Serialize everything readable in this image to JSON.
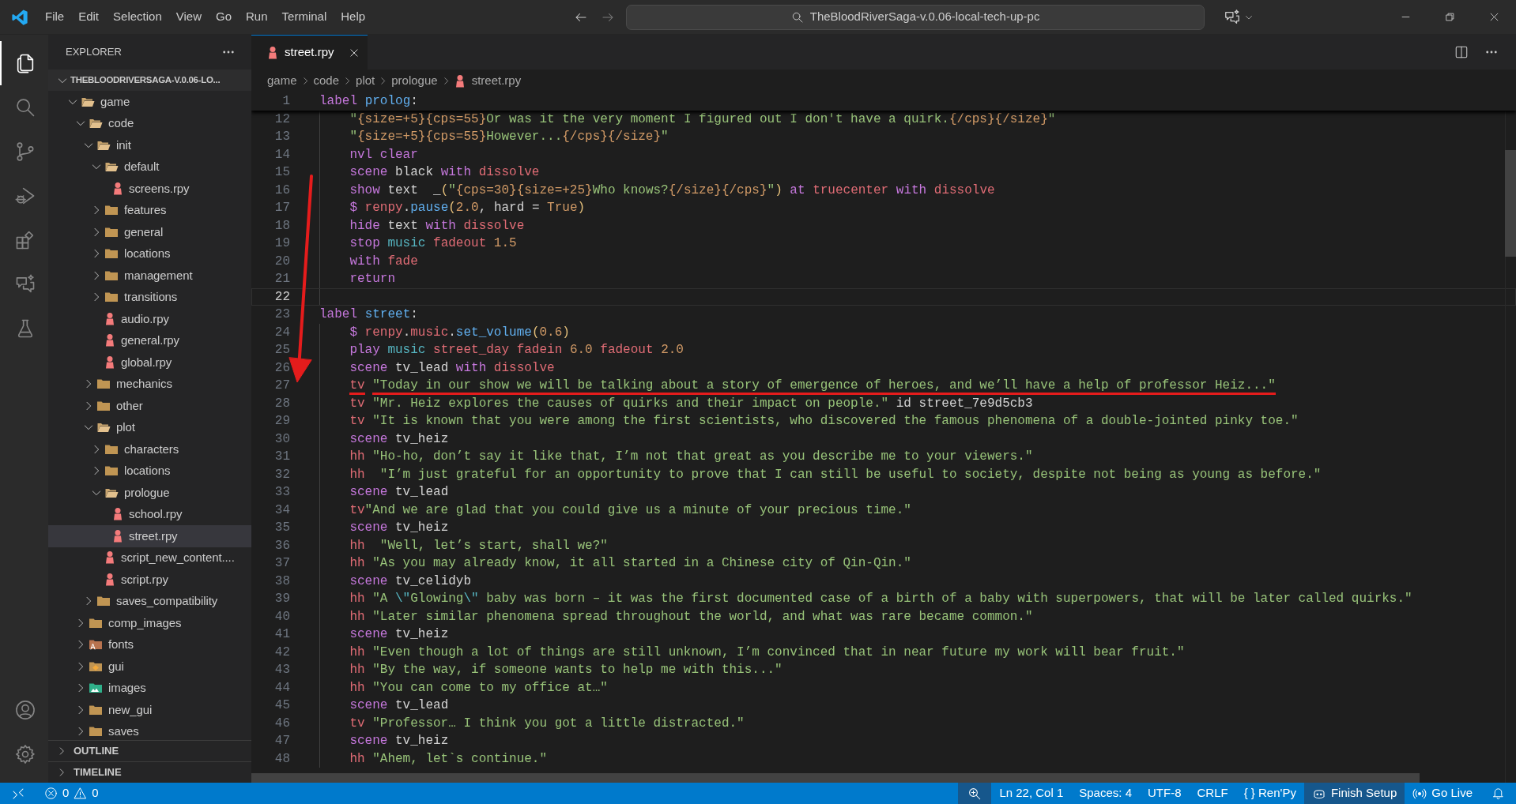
{
  "title_bar": {
    "menus": [
      "File",
      "Edit",
      "Selection",
      "View",
      "Go",
      "Run",
      "Terminal",
      "Help"
    ],
    "search": "TheBloodRiverSaga-v.0.06-local-tech-up-pc"
  },
  "activity_bar": {
    "top": [
      {
        "kind": "explorer",
        "selected": true
      },
      {
        "kind": "search",
        "selected": false
      },
      {
        "kind": "source_control",
        "selected": false
      },
      {
        "kind": "debug",
        "selected": false
      },
      {
        "kind": "extensions",
        "selected": false
      },
      {
        "kind": "chat",
        "selected": false
      },
      {
        "kind": "testing",
        "selected": false
      }
    ],
    "bottom": [
      {
        "kind": "account"
      },
      {
        "kind": "settings"
      }
    ]
  },
  "explorer": {
    "title": "EXPLORER",
    "root": {
      "name": "THEBLOODRIVERSAGA-V.0.06-LO...",
      "expanded": true
    },
    "tree": [
      {
        "name": "game",
        "kind": "folder",
        "expanded": true,
        "selected": false,
        "children": [
          {
            "name": "code",
            "kind": "folder",
            "expanded": true,
            "selected": false,
            "children": [
              {
                "name": "init",
                "kind": "folder",
                "expanded": true,
                "selected": false,
                "children": [
                  {
                    "name": "default",
                    "kind": "folder",
                    "expanded": true,
                    "selected": false,
                    "children": [
                      {
                        "name": "screens.rpy",
                        "kind": "file",
                        "selected": false
                      }
                    ]
                  },
                  {
                    "name": "features",
                    "kind": "folder",
                    "expanded": false,
                    "selected": false
                  },
                  {
                    "name": "general",
                    "kind": "folder",
                    "expanded": false,
                    "selected": false
                  },
                  {
                    "name": "locations",
                    "kind": "folder",
                    "expanded": false,
                    "selected": false
                  },
                  {
                    "name": "management",
                    "kind": "folder",
                    "expanded": false,
                    "selected": false
                  },
                  {
                    "name": "transitions",
                    "kind": "folder",
                    "expanded": false,
                    "selected": false
                  },
                  {
                    "name": "audio.rpy",
                    "kind": "file",
                    "selected": false
                  },
                  {
                    "name": "general.rpy",
                    "kind": "file",
                    "selected": false
                  },
                  {
                    "name": "global.rpy",
                    "kind": "file",
                    "selected": false
                  }
                ]
              },
              {
                "name": "mechanics",
                "kind": "folder",
                "expanded": false,
                "selected": false
              },
              {
                "name": "other",
                "kind": "folder",
                "expanded": false,
                "selected": false
              },
              {
                "name": "plot",
                "kind": "folder",
                "expanded": true,
                "selected": false,
                "children": [
                  {
                    "name": "characters",
                    "kind": "folder",
                    "expanded": false,
                    "selected": false
                  },
                  {
                    "name": "locations",
                    "kind": "folder",
                    "expanded": false,
                    "selected": false
                  },
                  {
                    "name": "prologue",
                    "kind": "folder",
                    "expanded": true,
                    "selected": false,
                    "children": [
                      {
                        "name": "school.rpy",
                        "kind": "file",
                        "selected": false
                      },
                      {
                        "name": "street.rpy",
                        "kind": "file",
                        "selected": true
                      }
                    ]
                  },
                  {
                    "name": "script_new_content....",
                    "kind": "file",
                    "selected": false
                  },
                  {
                    "name": "script.rpy",
                    "kind": "file",
                    "selected": false
                  }
                ]
              },
              {
                "name": "saves_compatibility",
                "kind": "folder",
                "expanded": false,
                "selected": false
              }
            ]
          },
          {
            "name": "comp_images",
            "kind": "folder",
            "expanded": false,
            "selected": false
          },
          {
            "name": "fonts",
            "kind": "font_folder",
            "expanded": false,
            "selected": false
          },
          {
            "name": "gui",
            "kind": "gui_folder",
            "expanded": false,
            "selected": false
          },
          {
            "name": "images",
            "kind": "image_folder",
            "expanded": false,
            "selected": false
          },
          {
            "name": "new_gui",
            "kind": "folder",
            "expanded": false,
            "selected": false
          },
          {
            "name": "saves",
            "kind": "folder",
            "expanded": false,
            "selected": false
          }
        ]
      }
    ],
    "sections": [
      {
        "title": "OUTLINE",
        "expanded": false
      },
      {
        "title": "TIMELINE",
        "expanded": false
      }
    ]
  },
  "tabs": [
    {
      "label": "street.rpy",
      "selected": true
    }
  ],
  "breadcrumb": [
    "game",
    "code",
    "plot",
    "prologue",
    "street.rpy"
  ],
  "editor": {
    "sticky_line": {
      "n": "1",
      "indented": false,
      "tokens": [
        {
          "kind": "kw",
          "text": "label "
        },
        {
          "kind": "name",
          "text": "prolog"
        },
        {
          "kind": "p",
          "text": ":"
        }
      ]
    },
    "lines": [
      {
        "n": "12",
        "indented": true,
        "current": false,
        "tokens": [
          {
            "kind": "str",
            "text": "\""
          },
          {
            "kind": "tag",
            "text": "{size=+5}{cps=55}"
          },
          {
            "kind": "str",
            "text": "Or was it the very moment I figured out I don't have a quirk."
          },
          {
            "kind": "tag",
            "text": "{/cps}{/size}"
          },
          {
            "kind": "str",
            "text": "\""
          }
        ]
      },
      {
        "n": "13",
        "indented": true,
        "current": false,
        "tokens": [
          {
            "kind": "str",
            "text": "\""
          },
          {
            "kind": "tag",
            "text": "{size=+5}{cps=55}"
          },
          {
            "kind": "str",
            "text": "However..."
          },
          {
            "kind": "tag",
            "text": "{/cps}{/size}"
          },
          {
            "kind": "str",
            "text": "\""
          }
        ]
      },
      {
        "n": "14",
        "indented": true,
        "current": false,
        "tokens": [
          {
            "kind": "kw",
            "text": "nvl clear"
          }
        ]
      },
      {
        "n": "15",
        "indented": true,
        "current": false,
        "tokens": [
          {
            "kind": "kw",
            "text": "scene "
          },
          {
            "kind": "p",
            "text": "black "
          },
          {
            "kind": "kw",
            "text": "with "
          },
          {
            "kind": "ent",
            "text": "dissolve"
          }
        ]
      },
      {
        "n": "16",
        "indented": true,
        "current": false,
        "tokens": [
          {
            "kind": "kw",
            "text": "show "
          },
          {
            "kind": "p",
            "text": "text  _"
          },
          {
            "kind": "paren",
            "text": "("
          },
          {
            "kind": "str",
            "text": "\""
          },
          {
            "kind": "tag",
            "text": "{cps=30}{size=+25}"
          },
          {
            "kind": "str",
            "text": "Who knows?"
          },
          {
            "kind": "tag",
            "text": "{/size}{/cps}"
          },
          {
            "kind": "str",
            "text": "\""
          },
          {
            "kind": "paren",
            "text": ") "
          },
          {
            "kind": "kw",
            "text": "at "
          },
          {
            "kind": "ent",
            "text": "truecenter "
          },
          {
            "kind": "kw",
            "text": "with "
          },
          {
            "kind": "ent",
            "text": "dissolve"
          }
        ]
      },
      {
        "n": "17",
        "indented": true,
        "current": false,
        "tokens": [
          {
            "kind": "kw",
            "text": "$ "
          },
          {
            "kind": "ent",
            "text": "renpy"
          },
          {
            "kind": "p",
            "text": "."
          },
          {
            "kind": "fn",
            "text": "pause"
          },
          {
            "kind": "paren",
            "text": "("
          },
          {
            "kind": "num",
            "text": "2.0"
          },
          {
            "kind": "p",
            "text": ", hard = "
          },
          {
            "kind": "num",
            "text": "True"
          },
          {
            "kind": "paren",
            "text": ")"
          }
        ]
      },
      {
        "n": "18",
        "indented": true,
        "current": false,
        "tokens": [
          {
            "kind": "kw",
            "text": "hide "
          },
          {
            "kind": "p",
            "text": "text "
          },
          {
            "kind": "kw",
            "text": "with "
          },
          {
            "kind": "ent",
            "text": "dissolve"
          }
        ]
      },
      {
        "n": "19",
        "indented": true,
        "current": false,
        "tokens": [
          {
            "kind": "kw",
            "text": "stop "
          },
          {
            "kind": "mus",
            "text": "music "
          },
          {
            "kind": "ent",
            "text": "fadeout "
          },
          {
            "kind": "num",
            "text": "1.5"
          }
        ]
      },
      {
        "n": "20",
        "indented": true,
        "current": false,
        "tokens": [
          {
            "kind": "kw",
            "text": "with "
          },
          {
            "kind": "ent",
            "text": "fade"
          }
        ]
      },
      {
        "n": "21",
        "indented": true,
        "current": false,
        "tokens": [
          {
            "kind": "kw",
            "text": "return"
          }
        ]
      },
      {
        "n": "22",
        "indented": true,
        "current": true
      },
      {
        "n": "23",
        "indented": false,
        "current": false,
        "tokens": [
          {
            "kind": "kw",
            "text": "label "
          },
          {
            "kind": "name",
            "text": "street"
          },
          {
            "kind": "p",
            "text": ":"
          }
        ]
      },
      {
        "n": "24",
        "indented": true,
        "current": false,
        "tokens": [
          {
            "kind": "kw",
            "text": "$ "
          },
          {
            "kind": "ent",
            "text": "renpy"
          },
          {
            "kind": "p",
            "text": "."
          },
          {
            "kind": "ent",
            "text": "music"
          },
          {
            "kind": "p",
            "text": "."
          },
          {
            "kind": "fn",
            "text": "set_volume"
          },
          {
            "kind": "paren",
            "text": "("
          },
          {
            "kind": "num",
            "text": "0.6"
          },
          {
            "kind": "paren",
            "text": ")"
          }
        ]
      },
      {
        "n": "25",
        "indented": true,
        "current": false,
        "tokens": [
          {
            "kind": "kw",
            "text": "play "
          },
          {
            "kind": "mus",
            "text": "music "
          },
          {
            "kind": "ent",
            "text": "street_day "
          },
          {
            "kind": "ent",
            "text": "fadein "
          },
          {
            "kind": "num",
            "text": "6.0 "
          },
          {
            "kind": "ent",
            "text": "fadeout "
          },
          {
            "kind": "num",
            "text": "2.0"
          }
        ]
      },
      {
        "n": "26",
        "indented": true,
        "current": false,
        "tokens": [
          {
            "kind": "kw",
            "text": "scene "
          },
          {
            "kind": "p",
            "text": "tv_lead "
          },
          {
            "kind": "kw",
            "text": "with "
          },
          {
            "kind": "ent",
            "text": "dissolve"
          }
        ]
      },
      {
        "n": "27",
        "indented": true,
        "current": false,
        "underlined": true,
        "tokens": [
          {
            "kind": "ent",
            "text": "tv "
          },
          {
            "kind": "str",
            "text": "\"Today in our show we will be talking about a story of emergence of heroes, and we’ll have a help of professor Heiz...\""
          }
        ]
      },
      {
        "n": "28",
        "indented": true,
        "current": false,
        "tokens": [
          {
            "kind": "ent",
            "text": "tv "
          },
          {
            "kind": "str",
            "text": "\"Mr. Heiz explores the causes of quirks and their impact on people.\" "
          },
          {
            "kind": "p",
            "text": "id street_7e9d5cb3"
          }
        ]
      },
      {
        "n": "29",
        "indented": true,
        "current": false,
        "tokens": [
          {
            "kind": "ent",
            "text": "tv "
          },
          {
            "kind": "str",
            "text": "\"It is known that you were among the first scientists, who discovered the famous phenomena of a double-jointed pinky toe.\""
          }
        ]
      },
      {
        "n": "30",
        "indented": true,
        "current": false,
        "tokens": [
          {
            "kind": "kw",
            "text": "scene "
          },
          {
            "kind": "p",
            "text": "tv_heiz"
          }
        ]
      },
      {
        "n": "31",
        "indented": true,
        "current": false,
        "tokens": [
          {
            "kind": "ent",
            "text": "hh "
          },
          {
            "kind": "str",
            "text": "\"Ho-ho, don’t say it like that, I’m not that great as you describe me to your viewers.\""
          }
        ]
      },
      {
        "n": "32",
        "indented": true,
        "current": false,
        "tokens": [
          {
            "kind": "ent",
            "text": "hh  "
          },
          {
            "kind": "str",
            "text": "\"I’m just grateful for an opportunity to prove that I can still be useful to society, despite not being as young as before.\""
          }
        ]
      },
      {
        "n": "33",
        "indented": true,
        "current": false,
        "tokens": [
          {
            "kind": "kw",
            "text": "scene "
          },
          {
            "kind": "p",
            "text": "tv_lead"
          }
        ]
      },
      {
        "n": "34",
        "indented": true,
        "current": false,
        "tokens": [
          {
            "kind": "ent",
            "text": "tv"
          },
          {
            "kind": "str",
            "text": "\"And we are glad that you could give us a minute of your precious time.\""
          }
        ]
      },
      {
        "n": "35",
        "indented": true,
        "current": false,
        "tokens": [
          {
            "kind": "kw",
            "text": "scene "
          },
          {
            "kind": "p",
            "text": "tv_heiz"
          }
        ]
      },
      {
        "n": "36",
        "indented": true,
        "current": false,
        "tokens": [
          {
            "kind": "ent",
            "text": "hh  "
          },
          {
            "kind": "str",
            "text": "\"Well, let’s start, shall we?\""
          }
        ]
      },
      {
        "n": "37",
        "indented": true,
        "current": false,
        "tokens": [
          {
            "kind": "ent",
            "text": "hh "
          },
          {
            "kind": "str",
            "text": "\"As you may already know, it all started in a Chinese city of Qin-Qin.\""
          }
        ]
      },
      {
        "n": "38",
        "indented": true,
        "current": false,
        "tokens": [
          {
            "kind": "kw",
            "text": "scene "
          },
          {
            "kind": "p",
            "text": "tv_celidyb"
          }
        ]
      },
      {
        "n": "39",
        "indented": true,
        "current": false,
        "tokens": [
          {
            "kind": "ent",
            "text": "hh "
          },
          {
            "kind": "str",
            "text": "\"A "
          },
          {
            "kind": "esc",
            "text": "\\\""
          },
          {
            "kind": "str",
            "text": "Glowing"
          },
          {
            "kind": "esc",
            "text": "\\\""
          },
          {
            "kind": "str",
            "text": " baby was born – it was the first documented case of a birth of a baby with superpowers, that will be later called quirks.\""
          }
        ]
      },
      {
        "n": "40",
        "indented": true,
        "current": false,
        "tokens": [
          {
            "kind": "ent",
            "text": "hh "
          },
          {
            "kind": "str",
            "text": "\"Later similar phenomena spread throughout the world, and what was rare became common.\""
          }
        ]
      },
      {
        "n": "41",
        "indented": true,
        "current": false,
        "tokens": [
          {
            "kind": "kw",
            "text": "scene "
          },
          {
            "kind": "p",
            "text": "tv_heiz"
          }
        ]
      },
      {
        "n": "42",
        "indented": true,
        "current": false,
        "tokens": [
          {
            "kind": "ent",
            "text": "hh "
          },
          {
            "kind": "str",
            "text": "\"Even though a lot of things are still unknown, I’m convinced that in near future my work will bear fruit.\""
          }
        ]
      },
      {
        "n": "43",
        "indented": true,
        "current": false,
        "tokens": [
          {
            "kind": "ent",
            "text": "hh "
          },
          {
            "kind": "str",
            "text": "\"By the way, if someone wants to help me with this...\""
          }
        ]
      },
      {
        "n": "44",
        "indented": true,
        "current": false,
        "tokens": [
          {
            "kind": "ent",
            "text": "hh "
          },
          {
            "kind": "str",
            "text": "\"You can come to my office at…\""
          }
        ]
      },
      {
        "n": "45",
        "indented": true,
        "current": false,
        "tokens": [
          {
            "kind": "kw",
            "text": "scene "
          },
          {
            "kind": "p",
            "text": "tv_lead"
          }
        ]
      },
      {
        "n": "46",
        "indented": true,
        "current": false,
        "tokens": [
          {
            "kind": "ent",
            "text": "tv "
          },
          {
            "kind": "str",
            "text": "\"Professor… I think you got a little distracted.\""
          }
        ]
      },
      {
        "n": "47",
        "indented": true,
        "current": false,
        "tokens": [
          {
            "kind": "kw",
            "text": "scene "
          },
          {
            "kind": "p",
            "text": "tv_heiz"
          }
        ]
      },
      {
        "n": "48",
        "indented": true,
        "current": false,
        "tokens": [
          {
            "kind": "ent",
            "text": "hh "
          },
          {
            "kind": "str",
            "text": "\"Ahem, let`s continue.\""
          }
        ]
      }
    ]
  },
  "status_bar": {
    "errors": "0",
    "warnings": "0",
    "items": [
      {
        "kind": "zoom"
      },
      {
        "kind": "text",
        "text": "Ln 22, Col 1"
      },
      {
        "kind": "text",
        "text": "Spaces: 4"
      },
      {
        "kind": "text",
        "text": "UTF-8"
      },
      {
        "kind": "text",
        "text": "CRLF"
      },
      {
        "kind": "language",
        "glyph": "{ }",
        "text": "Ren'Py"
      },
      {
        "kind": "copilot",
        "text": "Finish Setup"
      },
      {
        "kind": "live",
        "text": "Go Live"
      },
      {
        "kind": "bell"
      }
    ]
  }
}
